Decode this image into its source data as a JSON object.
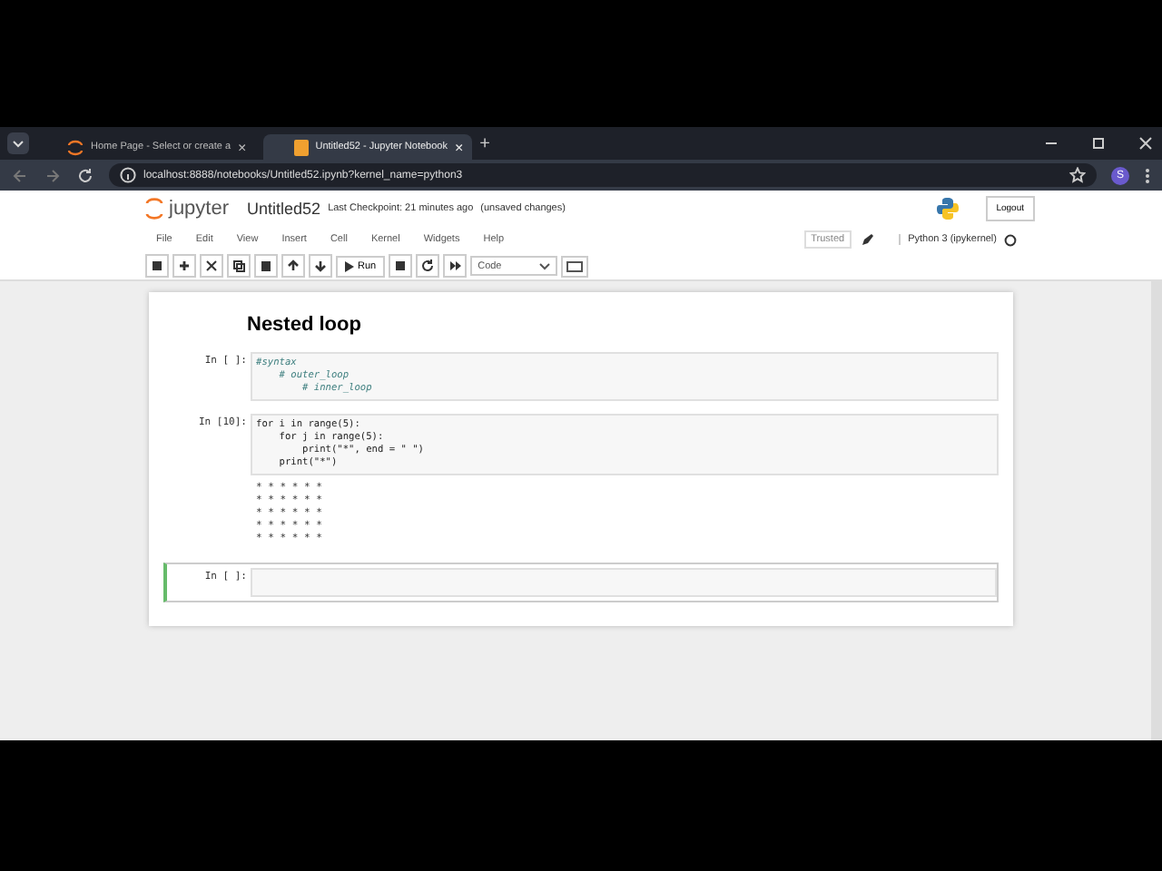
{
  "browser": {
    "tabs": [
      {
        "label": "Home Page - Select or create a",
        "selected": false
      },
      {
        "label": "Untitled52 - Jupyter Notebook",
        "selected": true
      }
    ],
    "tab_close": "×",
    "new_tab": "+",
    "address": "localhost:8888/notebooks/Untitled52.ipynb?kernel_name=python3",
    "profile": "S"
  },
  "header": {
    "logo": "jupyter",
    "title": "Untitled52",
    "checkpoint": "Last Checkpoint: 21 minutes ago",
    "unsaved": "(unsaved changes)",
    "logout": "Logout"
  },
  "menu": {
    "items": [
      "File",
      "Edit",
      "View",
      "Insert",
      "Cell",
      "Kernel",
      "Widgets",
      "Help"
    ],
    "trusted": "Trusted",
    "kernel": "Python 3 (ipykernel)"
  },
  "toolbar": {
    "run": "Run",
    "cell_type": "Code"
  },
  "notebook": {
    "heading": "Nested loop",
    "cells": [
      {
        "prompt": "In [ ]:",
        "selected": false,
        "lines": [
          {
            "kind": "comment",
            "text": "#syntax"
          },
          {
            "kind": "comment",
            "text": "    # outer_loop"
          },
          {
            "kind": "comment",
            "text": "        # inner_loop"
          }
        ]
      },
      {
        "prompt": "In [10]:",
        "selected": false,
        "lines": [
          {
            "kind": "code",
            "text": "for i in range(5):"
          },
          {
            "kind": "code",
            "text": "    for j in range(5):"
          },
          {
            "kind": "code",
            "text": "        print(\"*\", end = \" \")"
          },
          {
            "kind": "code",
            "text": "    print(\"*\")"
          }
        ],
        "output": [
          "* * * * * *",
          "* * * * * *",
          "* * * * * *",
          "* * * * * *",
          "* * * * * *"
        ]
      },
      {
        "prompt": "In [ ]:",
        "selected": true
      }
    ]
  }
}
